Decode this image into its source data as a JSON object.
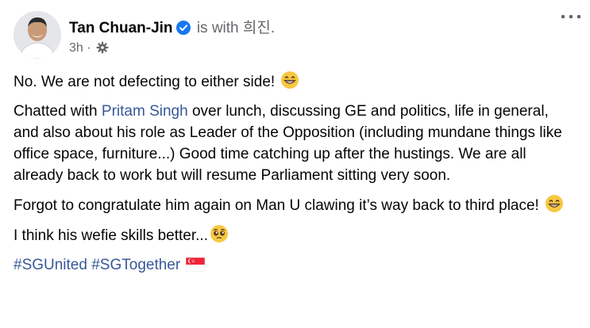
{
  "post": {
    "author": "Tan Chuan-Jin",
    "with_text": "is with",
    "with_name": "희진.",
    "time": "3h",
    "separator": "·",
    "icons": {
      "verified": "verified-badge-icon",
      "privacy": "gear-icon",
      "more": "more-options-icon"
    },
    "paragraphs": {
      "p1": "No. We are not defecting to either side!",
      "p2_before": "Chatted with ",
      "p2_mention": "Pritam Singh",
      "p2_after": " over lunch, discussing GE and politics, life in general, and also about his role as Leader of the Opposition (including mundane things like office space, furniture...) Good time catching up after the hustings. We are all already back to work but will resume Parliament sitting very soon.",
      "p3": "Forgot to congratulate him again on Man U clawing it’s way back to third place!",
      "p4": "I think his wefie skills better..."
    },
    "hashtags": [
      "#SGUnited",
      "#SGTogether"
    ],
    "emojis": {
      "grin": "grinning-face-emoji",
      "pleading": "pleading-face-emoji",
      "flag": "singapore-flag-emoji"
    },
    "colors": {
      "link": "#385898",
      "verified": "#1877f2",
      "meta": "#65676b"
    }
  }
}
